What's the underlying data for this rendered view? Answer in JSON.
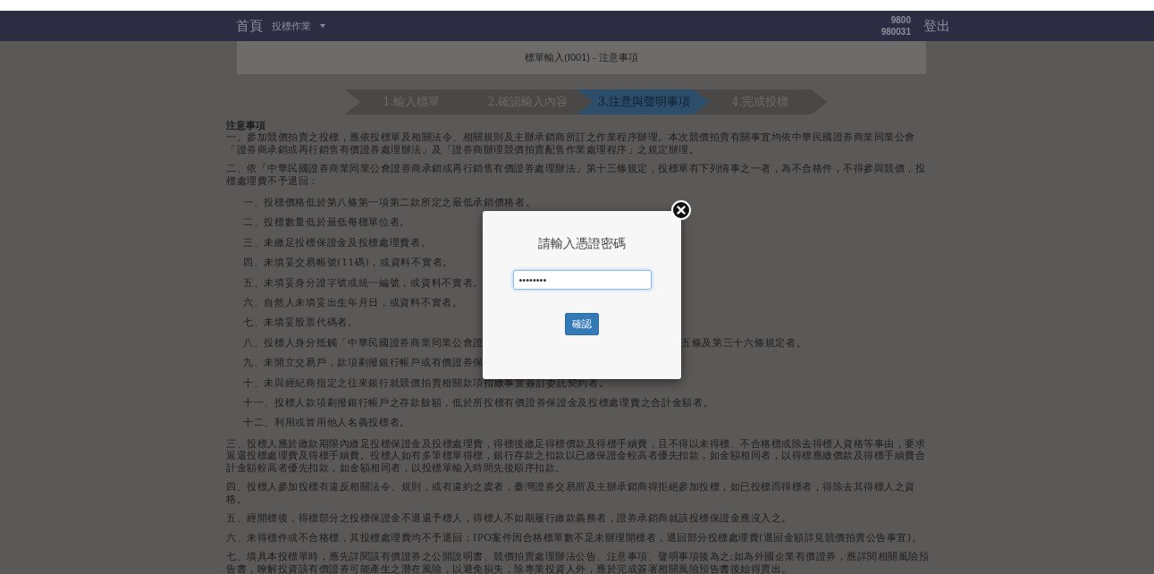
{
  "header": {
    "home": "首頁",
    "menu": "投標作業",
    "user_lines": [
      "9800",
      "980031"
    ],
    "logout": "登出"
  },
  "page_title": "標單輸入(I001) - 注意事項",
  "steps": [
    {
      "label": "1.輸入標單",
      "selected": false
    },
    {
      "label": "2.確認輸入內容",
      "selected": false
    },
    {
      "label": "3.注意與聲明事項",
      "selected": true
    },
    {
      "label": "4.完成投標",
      "selected": false
    }
  ],
  "notice": {
    "heading": "注意事項",
    "sections": [
      {
        "text": "一、參加競價拍賣之投標，應依投標單及相關法令、相關規則及主辦承銷商所訂之作業程序辦理。本次競價拍賣有關事宜均依中華民國證券商業同業公會「證券商承銷或再行銷售有價證券處理辦法」及「證券商辦理競價拍賣配售作業處理程序」之規定辦理。"
      },
      {
        "text": "二、依「中華民國證券商業同業公會證券商承銷或再行銷售有價證券處理辦法」第十三條規定，投標單有下列情事之一者，為不合格件，不得參與競價，投標處理費不予退回：",
        "children": [
          {
            "text": "一、投標價格低於第八條第一項第二款所定之最低承銷價格者。"
          },
          {
            "text": "二、投標數量低於最低每標單位者。"
          },
          {
            "text": "三、未繳足投標保證金及投標處理費者。"
          },
          {
            "text": "四、未填妥交易帳號(11碼)，或資料不實者。"
          },
          {
            "text": "五、未填妥身分證字號或統一編號，或資料不實者。"
          },
          {
            "text": "六、自然人未填妥出生年月日，或資料不實者。"
          },
          {
            "text": "七、未填妥股票代碼者。"
          },
          {
            "text": "八、投標人身分抵觸「中華民國證券商業同業公會證",
            "text_after_dialog": "五條及第三十六條規定者。"
          },
          {
            "text": "九、未開立交易戶，款項劃撥銀行帳戶或有價證券保"
          },
          {
            "text": "十、未與經紀商指定之往來銀行就競價拍賣相關款項扣繳事宜簽訂委託契約者。"
          },
          {
            "text": "十一、投標人款項劃撥銀行帳戶之存款餘額，低於所投標有價證券保證金及投標處理費之合計金額者。"
          },
          {
            "text": "十二、利用或冒用他人名義投標者。"
          }
        ]
      },
      {
        "text": "三、投標人應於繳款期限內繳足投標保證金及投標處理費，得標後繳足得標價款及得標手續費，且不得以未得標、不合格標或除去得標人資格等事由，要求返還投標處理費及得標手續費。投標人如有多筆標單得標，銀行存款之扣款以已繳保證金較高者優先扣款，如金額相同者，以得標應繳價款及得標手續費合計金額較高者優先扣款，如金額相同者，以投標單輸入時間先後順序扣款。"
      },
      {
        "text": "四、投標人參加投標有違反相關法令、規則，或有違約之虞者，臺灣證券交易所及主辦承銷商得拒絕參加投標，如已投標而得標者，得除去其得標人之資格。"
      },
      {
        "text": "五、經開標後，得標部分之投標保證金不退還予標人，得標人不如期履行繳款義務者，證券承銷商就該投標保證金應沒入之。"
      },
      {
        "text": "六、未得標件或不合格標，其投標處理費均不予退回；IPO案件因合格標單數不足未辦理開標者，退回部分投標處理費(退回金額詳見競價拍賣公告事宜)。"
      },
      {
        "text": "七、填具本投標單時，應先詳閱該有價證券之公開說明書、競價拍賣處理辦法公告、注意事項、聲明事項後為之;如為外國企業有價證券，應詳閱相關風險預告書，瞭解投資該有價證券可能產生之潛在風險，以避免損失，除專業投資人外，應於完成簽署相關風險預告書後始得賣出。"
      }
    ]
  },
  "dialog": {
    "title": "請輸入憑證密碼",
    "password": {
      "value": "••••••••"
    },
    "confirm": "確認"
  }
}
